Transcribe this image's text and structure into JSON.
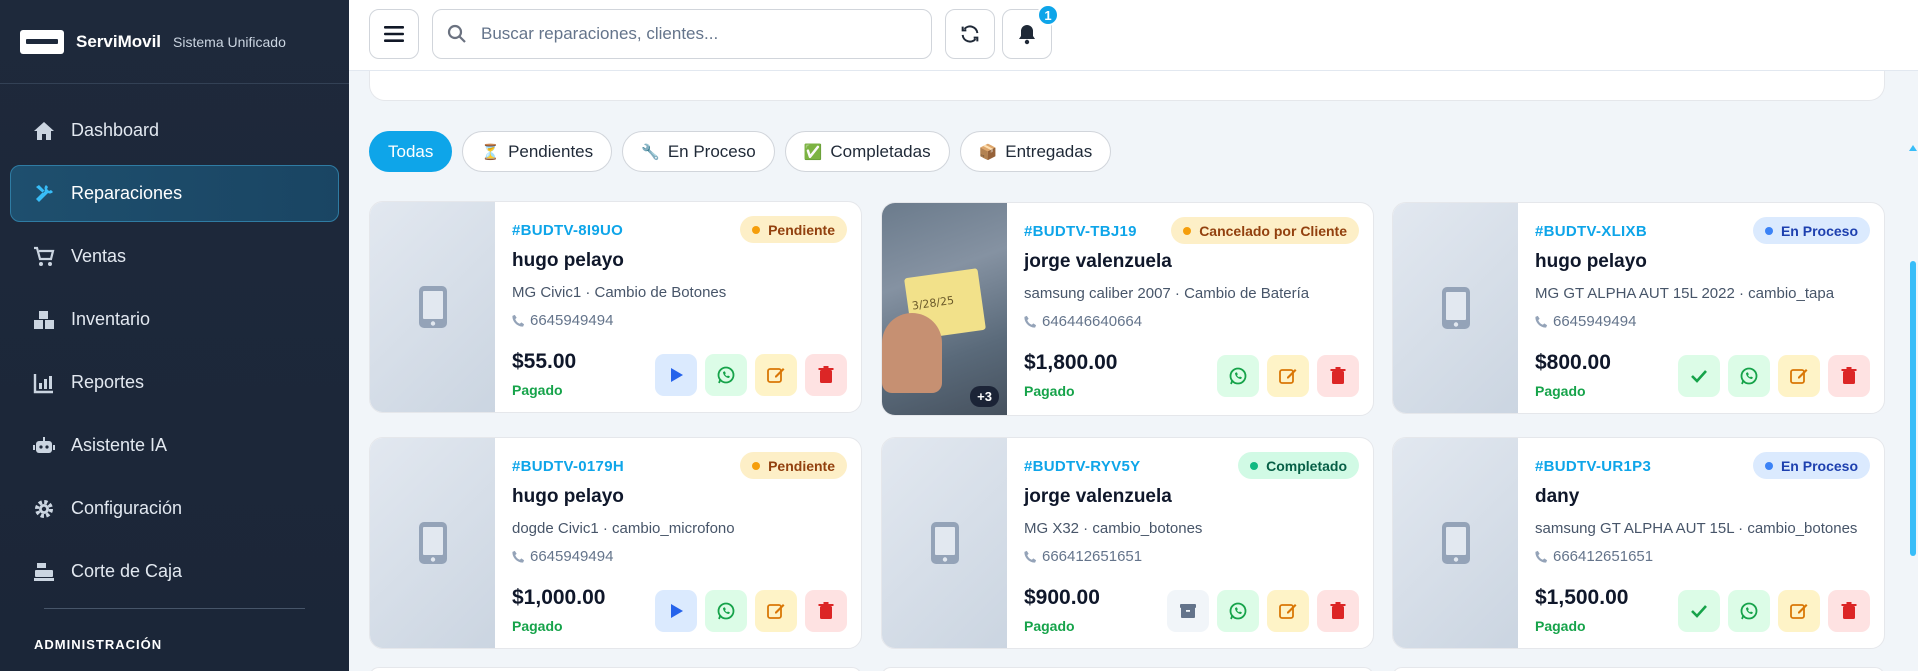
{
  "brand": {
    "name": "ServiMovil",
    "subtitle": "Sistema Unificado"
  },
  "sidebar": {
    "items": [
      {
        "label": "Dashboard",
        "icon": "home-icon"
      },
      {
        "label": "Reparaciones",
        "icon": "tools-icon",
        "active": true
      },
      {
        "label": "Ventas",
        "icon": "cart-icon"
      },
      {
        "label": "Inventario",
        "icon": "boxes-icon"
      },
      {
        "label": "Reportes",
        "icon": "chart-icon"
      },
      {
        "label": "Asistente IA",
        "icon": "robot-icon"
      },
      {
        "label": "Configuración",
        "icon": "gear-icon"
      },
      {
        "label": "Corte de Caja",
        "icon": "cash-register-icon"
      }
    ],
    "section_label": "ADMINISTRACIÓN"
  },
  "topbar": {
    "search_placeholder": "Buscar reparaciones, clientes...",
    "notifications_count": "1"
  },
  "filters": [
    {
      "label": "Todas",
      "icon": ""
    },
    {
      "label": "Pendientes",
      "icon": "⏳"
    },
    {
      "label": "En Proceso",
      "icon": "🔧"
    },
    {
      "label": "Completadas",
      "icon": "✅"
    },
    {
      "label": "Entregadas",
      "icon": "📦"
    }
  ],
  "cards": [
    {
      "code": "#BUDTV-8I9UO",
      "status": "Pendiente",
      "client": "hugo pelayo",
      "device": "MG Civic1 · Cambio de Botones",
      "phone": "6645949494",
      "price": "$55.00",
      "payment": "Pagado"
    },
    {
      "code": "#BUDTV-TBJ19",
      "status": "Cancelado por Cliente",
      "client": "jorge valenzuela",
      "device": "samsung caliber 2007 · Cambio de Batería",
      "phone": "646446640664",
      "price": "$1,800.00",
      "payment": "Pagado",
      "photo_extra": "+3",
      "photo_note": "3/28/25"
    },
    {
      "code": "#BUDTV-XLIXB",
      "status": "En Proceso",
      "client": "hugo pelayo",
      "device": "MG GT ALPHA AUT 15L 2022 · cambio_tapa",
      "phone": "6645949494",
      "price": "$800.00",
      "payment": "Pagado"
    },
    {
      "code": "#BUDTV-0179H",
      "status": "Pendiente",
      "client": "hugo pelayo",
      "device": "dogde Civic1 · cambio_microfono",
      "phone": "6645949494",
      "price": "$1,000.00",
      "payment": "Pagado"
    },
    {
      "code": "#BUDTV-RYV5Y",
      "status": "Completado",
      "client": "jorge valenzuela",
      "device": "MG X32 · cambio_botones",
      "phone": "666412651651",
      "price": "$900.00",
      "payment": "Pagado"
    },
    {
      "code": "#BUDTV-UR1P3",
      "status": "En Proceso",
      "client": "dany",
      "device": "samsung GT ALPHA AUT 15L · cambio_botones",
      "phone": "666412651651",
      "price": "$1,500.00",
      "payment": "Pagado"
    }
  ],
  "colors": {
    "accent": "#0ea5e9",
    "sidebar": "#1e293b",
    "paid": "#16a34a"
  }
}
